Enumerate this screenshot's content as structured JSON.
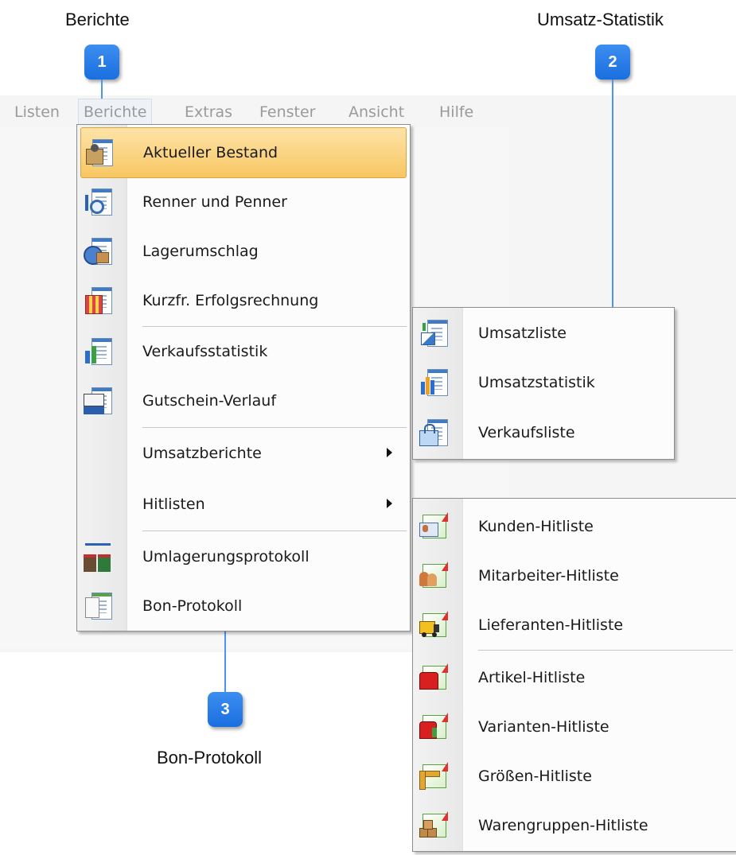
{
  "callouts": [
    {
      "number": "1",
      "label": "Berichte"
    },
    {
      "number": "2",
      "label": "Umsatz-Statistik"
    },
    {
      "number": "3",
      "label": "Bon-Protokoll"
    }
  ],
  "menubar": {
    "items": [
      "Listen",
      "Berichte",
      "Extras",
      "Fenster",
      "Ansicht",
      "Hilfe"
    ]
  },
  "berichte_menu": {
    "items": [
      {
        "label": "Aktueller Bestand",
        "icon": "inventory-icon",
        "highlighted": true
      },
      {
        "label": "Renner und Penner",
        "icon": "sort-search-icon"
      },
      {
        "label": "Lagerumschlag",
        "icon": "clock-box-icon"
      },
      {
        "label": "Kurzfr. Erfolgsrechnung",
        "icon": "building-report-icon"
      },
      {
        "label": "Verkaufsstatistik",
        "icon": "sales-chart-icon"
      },
      {
        "label": "Gutschein-Verlauf",
        "icon": "voucher-icon"
      },
      {
        "label": "Umsatzberichte",
        "submenu": true
      },
      {
        "label": "Hitlisten",
        "submenu": true
      },
      {
        "label": "Umlagerungsprotokoll",
        "icon": "transfer-stores-icon"
      },
      {
        "label": "Bon-Protokoll",
        "icon": "receipt-icon"
      }
    ]
  },
  "umsatz_submenu": {
    "items": [
      {
        "label": "Umsatzliste",
        "icon": "revenue-list-icon"
      },
      {
        "label": "Umsatzstatistik",
        "icon": "revenue-chart-icon"
      },
      {
        "label": "Verkaufsliste",
        "icon": "shopping-bag-icon"
      }
    ]
  },
  "hitlisten_submenu": {
    "items": [
      {
        "label": "Kunden-Hitliste",
        "icon": "customer-card-icon"
      },
      {
        "label": "Mitarbeiter-Hitliste",
        "icon": "employees-icon"
      },
      {
        "label": "Lieferanten-Hitliste",
        "icon": "truck-icon"
      },
      {
        "label": "Artikel-Hitliste",
        "icon": "shirt-icon"
      },
      {
        "label": "Varianten-Hitliste",
        "icon": "shirt-variant-icon"
      },
      {
        "label": "Größen-Hitliste",
        "icon": "ruler-icon"
      },
      {
        "label": "Warengruppen-Hitliste",
        "icon": "boxes-icon"
      }
    ]
  }
}
